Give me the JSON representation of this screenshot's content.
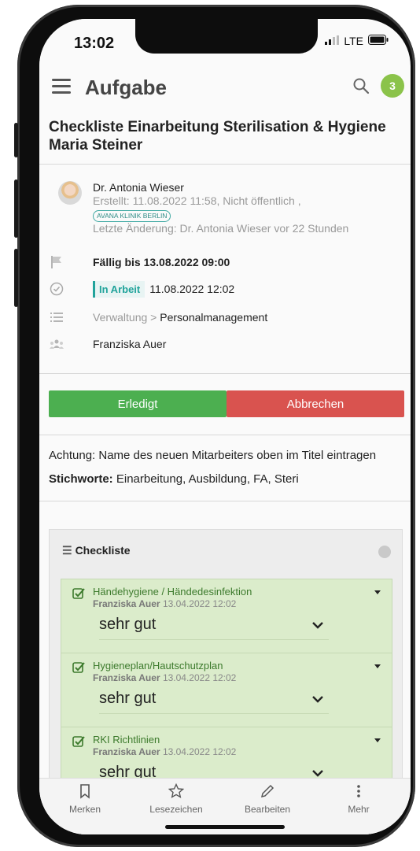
{
  "status_bar": {
    "time": "13:02",
    "network": "LTE"
  },
  "app_bar": {
    "title": "Aufgabe",
    "notification_count": "3"
  },
  "task": {
    "title": "Checkliste Einarbeitung Sterilisation & Hygiene Maria Steiner",
    "author": "Dr. Antonia Wieser",
    "created": "Erstellt: 11.08.2022 11:58, Nicht öffentlich ,",
    "tag": "AVANA KLINIK BERLIN",
    "last_change": "Letzte Änderung: Dr. Antonia Wieser vor 22 Stunden",
    "due": "Fällig bis 13.08.2022 09:00",
    "status_label": "In Arbeit",
    "status_date": "11.08.2022 12:02",
    "category_parent": "Verwaltung",
    "category_separator": ">",
    "category_child": "Personalmanagement",
    "assignee": "Franziska Auer"
  },
  "actions": {
    "done_label": "Erledigt",
    "cancel_label": "Abbrechen"
  },
  "notes": {
    "instruction": "Achtung: Name des neuen Mitarbeiters oben im Titel eintragen",
    "keywords_label": "Stichworte:",
    "keywords_value": "Einarbeitung, Ausbildung, FA, Steri"
  },
  "checklist": {
    "title": "Checkliste",
    "items": [
      {
        "name": "Händehygiene / Händedesinfektion",
        "user": "Franziska Auer",
        "date": "13.04.2022 12:02",
        "rating": "sehr gut"
      },
      {
        "name": "Hygieneplan/Hautschutzplan",
        "user": "Franziska Auer",
        "date": "13.04.2022 12:02",
        "rating": "sehr gut"
      },
      {
        "name": "RKI Richtlinien",
        "user": "Franziska Auer",
        "date": "13.04.2022 12:02",
        "rating": "sehr gut"
      }
    ]
  },
  "bottom_nav": [
    {
      "label": "Merken",
      "icon": "bookmark-icon"
    },
    {
      "label": "Lesezeichen",
      "icon": "star-icon"
    },
    {
      "label": "Bearbeiten",
      "icon": "pencil-icon"
    },
    {
      "label": "Mehr",
      "icon": "more-vertical-icon"
    }
  ],
  "colors": {
    "accent": "#21a39b",
    "done": "#4caf50",
    "cancel": "#d9534f",
    "badge": "#8bc34a",
    "checklist_item": "#dbeccb"
  }
}
